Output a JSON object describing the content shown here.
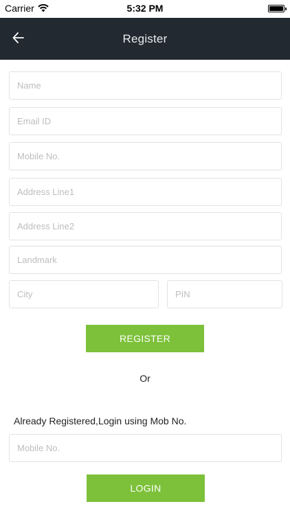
{
  "status_bar": {
    "carrier": "Carrier",
    "time": "5:32 PM",
    "wifi_icon": "wifi-icon",
    "battery_icon": "battery-icon"
  },
  "nav": {
    "back_icon": "arrow-left-icon",
    "title": "Register",
    "background": "#222931"
  },
  "register_form": {
    "name_placeholder": "Name",
    "email_placeholder": "Email ID",
    "mobile_placeholder": "Mobile No.",
    "address1_placeholder": "Address Line1",
    "address2_placeholder": "Address Line2",
    "landmark_placeholder": "Landmark",
    "city_placeholder": "City",
    "pin_placeholder": "PIN",
    "register_label": "REGISTER"
  },
  "separator_text": "Or",
  "login_section": {
    "hint": "Already Registered,Login using Mob No.",
    "mobile_placeholder": "Mobile No.",
    "login_label": "LOGIN"
  },
  "colors": {
    "accent_green": "#7dc13a",
    "field_border": "#e2e2e2",
    "placeholder": "#bdbdbd"
  }
}
